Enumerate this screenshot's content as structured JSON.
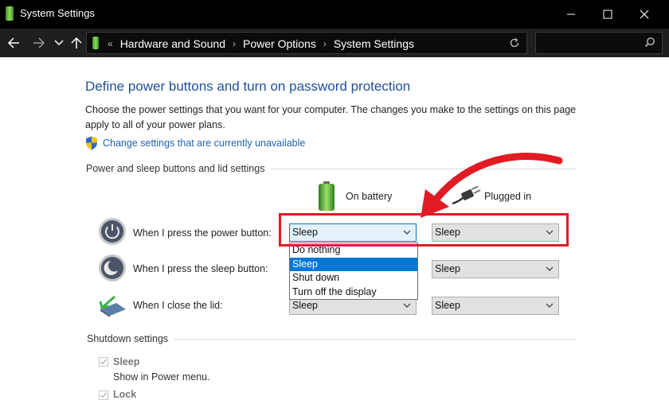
{
  "window": {
    "title": "System Settings"
  },
  "nav": {
    "back_icon": "arrow-left-icon",
    "forward_icon": "arrow-right-icon",
    "recent_icon": "chevron-down-icon",
    "up_icon": "arrow-up-icon"
  },
  "breadcrumbs": [
    "Hardware and Sound",
    "Power Options",
    "System Settings"
  ],
  "search": {
    "placeholder": ""
  },
  "main": {
    "heading": "Define power buttons and turn on password protection",
    "description": "Choose the power settings that you want for your computer. The changes you make to the settings on this page apply to all of your power plans.",
    "change_link": "Change settings that are currently unavailable",
    "buttons_group": {
      "label": "Power and sleep buttons and lid settings",
      "columns": {
        "battery": "On battery",
        "plugged": "Plugged in"
      },
      "rows": [
        {
          "label": "When I press the power button:",
          "battery": "Sleep",
          "plugged": "Sleep"
        },
        {
          "label": "When I press the sleep button:",
          "battery": "Sleep",
          "plugged": "Sleep"
        },
        {
          "label": "When I close the lid:",
          "battery": "Sleep",
          "plugged": "Sleep"
        }
      ],
      "dropdown_options": [
        "Do nothing",
        "Sleep",
        "Shut down",
        "Turn off the display"
      ],
      "dropdown_selected": "Sleep"
    },
    "shutdown_group": {
      "label": "Shutdown settings",
      "items": [
        {
          "label": "Sleep",
          "sub": "Show in Power menu.",
          "checked": true
        },
        {
          "label": "Lock",
          "checked": true
        }
      ]
    }
  },
  "annotation": {
    "color": "#e01b24"
  }
}
